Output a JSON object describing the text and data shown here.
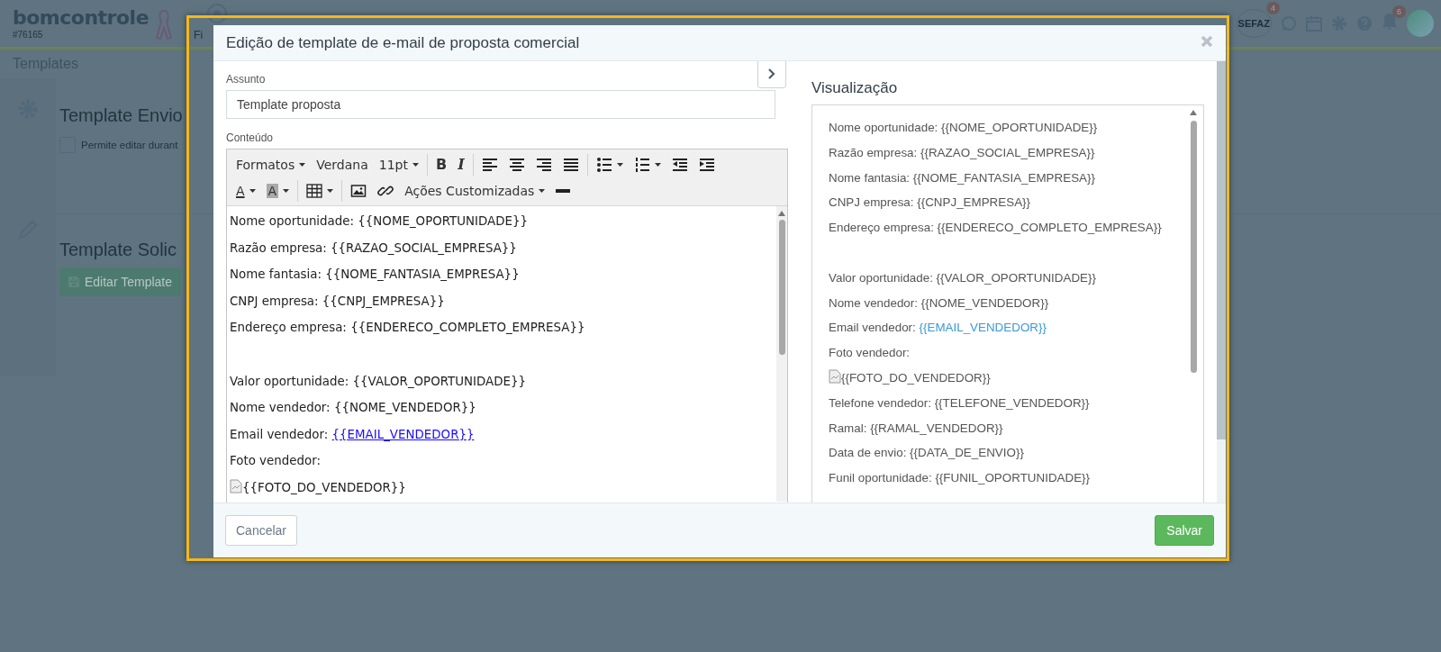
{
  "app": {
    "logo": "bomcontrole",
    "account_number": "#76165",
    "nav_partial_label": "Fi",
    "sefaz": {
      "label": "SEFAZ",
      "badge": "4"
    },
    "notifications_badge": "6"
  },
  "page": {
    "title": "Templates",
    "sections": [
      {
        "kind": "settings",
        "title": "Template Envio",
        "checkbox": {
          "label": "Permite editar durant",
          "checked": false
        }
      },
      {
        "kind": "edit",
        "title": "Template Solic",
        "button": "Editar Template"
      }
    ]
  },
  "modal": {
    "title": "Edição de template de e-mail de proposta comercial",
    "subject": {
      "label": "Assunto",
      "value": "Template proposta"
    },
    "content": {
      "label": "Conteúdo",
      "toolbar": [
        [
          {
            "kind": "menu",
            "label": "Formatos"
          },
          {
            "kind": "label",
            "label": "Verdana"
          },
          {
            "kind": "menu",
            "label": "11pt"
          },
          {
            "kind": "separator"
          },
          {
            "kind": "bold",
            "label": "B"
          },
          {
            "kind": "italic",
            "label": "I"
          },
          {
            "kind": "separator"
          },
          {
            "kind": "align-left",
            "dropdown": false
          },
          {
            "kind": "align-center",
            "dropdown": false
          },
          {
            "kind": "align-right",
            "dropdown": false
          },
          {
            "kind": "align-justify",
            "dropdown": false
          },
          {
            "kind": "separator"
          },
          {
            "kind": "bullet-list",
            "dropdown": true
          },
          {
            "kind": "number-list",
            "dropdown": true
          },
          {
            "kind": "outdent",
            "dropdown": false
          },
          {
            "kind": "indent",
            "dropdown": false
          }
        ],
        [
          {
            "kind": "forecolor",
            "label": "A"
          },
          {
            "kind": "backcolor",
            "label": "A"
          },
          {
            "kind": "separator"
          },
          {
            "kind": "table",
            "dropdown": true
          },
          {
            "kind": "separator"
          },
          {
            "kind": "image",
            "dropdown": false
          },
          {
            "kind": "link",
            "dropdown": false
          },
          {
            "kind": "menu",
            "label": "Ações Customizadas"
          },
          {
            "kind": "horizontal-rule",
            "dropdown": false
          }
        ]
      ],
      "lines": [
        {
          "kind": "text",
          "label": "Nome oportunidade:",
          "value": "{{NOME_OPORTUNIDADE}}"
        },
        {
          "kind": "text",
          "label": "Razão empresa:",
          "value": "{{RAZAO_SOCIAL_EMPRESA}}"
        },
        {
          "kind": "text",
          "label": "Nome fantasia:",
          "value": "{{NOME_FANTASIA_EMPRESA}}"
        },
        {
          "kind": "text",
          "label": "CNPJ empresa:",
          "value": "{{CNPJ_EMPRESA}}"
        },
        {
          "kind": "text",
          "label": "Endereço empresa:",
          "value": "{{ENDERECO_COMPLETO_EMPRESA}}"
        },
        {
          "kind": "blank"
        },
        {
          "kind": "text",
          "label": "Valor oportunidade:",
          "value": "{{VALOR_OPORTUNIDADE}}"
        },
        {
          "kind": "text",
          "label": "Nome vendedor:",
          "value": "{{NOME_VENDEDOR}}"
        },
        {
          "kind": "link",
          "label": "Email vendedor:",
          "value": "{{EMAIL_VENDEDOR}}"
        },
        {
          "kind": "text",
          "label": "Foto vendedor:"
        },
        {
          "kind": "image",
          "value": "{{FOTO_DO_VENDEDOR}}"
        }
      ]
    },
    "preview": {
      "title": "Visualização",
      "lines": [
        {
          "kind": "text",
          "label": "Nome oportunidade:",
          "value": "{{NOME_OPORTUNIDADE}}"
        },
        {
          "kind": "text",
          "label": "Razão empresa:",
          "value": "{{RAZAO_SOCIAL_EMPRESA}}"
        },
        {
          "kind": "text",
          "label": "Nome fantasia:",
          "value": "{{NOME_FANTASIA_EMPRESA}}"
        },
        {
          "kind": "text",
          "label": "CNPJ empresa:",
          "value": "{{CNPJ_EMPRESA}}"
        },
        {
          "kind": "text",
          "label": "Endereço empresa:",
          "value": "{{ENDERECO_COMPLETO_EMPRESA}}"
        },
        {
          "kind": "blank"
        },
        {
          "kind": "text",
          "label": "Valor oportunidade:",
          "value": "{{VALOR_OPORTUNIDADE}}"
        },
        {
          "kind": "text",
          "label": "Nome vendedor:",
          "value": "{{NOME_VENDEDOR}}"
        },
        {
          "kind": "link",
          "label": "Email vendedor:",
          "value": "{{EMAIL_VENDEDOR}}"
        },
        {
          "kind": "text",
          "label": "Foto vendedor:"
        },
        {
          "kind": "image",
          "value": "{{FOTO_DO_VENDEDOR}}"
        },
        {
          "kind": "text",
          "label": "Telefone vendedor:",
          "value": "{{TELEFONE_VENDEDOR}}"
        },
        {
          "kind": "text",
          "label": "Ramal:",
          "value": "{{RAMAL_VENDEDOR}}"
        },
        {
          "kind": "text",
          "label": "Data de envio:",
          "value": "{{DATA_DE_ENVIO}}"
        },
        {
          "kind": "text",
          "label": "Funil oportunidade:",
          "value": "{{FUNIL_OPORTUNIDADE}}"
        }
      ]
    },
    "buttons": {
      "cancel": "Cancelar",
      "save": "Salvar"
    }
  }
}
